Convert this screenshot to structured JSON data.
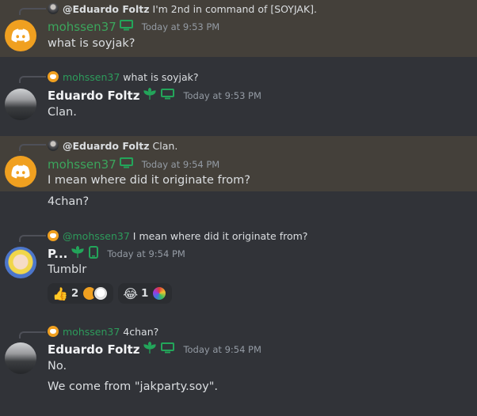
{
  "messages": [
    {
      "reply": {
        "name": "@Eduardo Foltz",
        "text": "I'm 2nd in command of [SOYJAK]."
      },
      "author": "mohssen37",
      "timestamp": "Today at 9:53 PM",
      "lines": [
        "what is soyjak?"
      ]
    },
    {
      "reply": {
        "name": "mohssen37",
        "text": "what is soyjak?"
      },
      "author": "Eduardo Foltz",
      "timestamp": "Today at 9:53 PM",
      "lines": [
        "Clan."
      ]
    },
    {
      "reply": {
        "name": "@Eduardo Foltz",
        "text": "Clan."
      },
      "author": "mohssen37",
      "timestamp": "Today at 9:54 PM",
      "lines": [
        "I mean where did it originate from?",
        "4chan?"
      ]
    },
    {
      "reply": {
        "name": "@mohssen37",
        "text": "I mean where did it originate from?"
      },
      "author": "P...",
      "timestamp": "Today at 9:54 PM",
      "lines": [
        "Tumblr"
      ],
      "reactions": [
        {
          "emoji": "👍",
          "count": "2"
        },
        {
          "emoji": "😂",
          "count": "1"
        }
      ]
    },
    {
      "reply": {
        "name": "mohssen37",
        "text": "4chan?"
      },
      "author": "Eduardo Foltz",
      "timestamp": "Today at 9:54 PM",
      "lines": [
        "No.",
        "We come from \"jakparty.soy\"."
      ]
    }
  ],
  "colors": {
    "background": "#313338",
    "highlight": "#44403a",
    "green_name": "#3ba55c",
    "badge_green": "#23a55a"
  },
  "icons": [
    "desktop-icon",
    "leaf-badge-icon",
    "mobile-icon",
    "discord-logo-icon"
  ]
}
